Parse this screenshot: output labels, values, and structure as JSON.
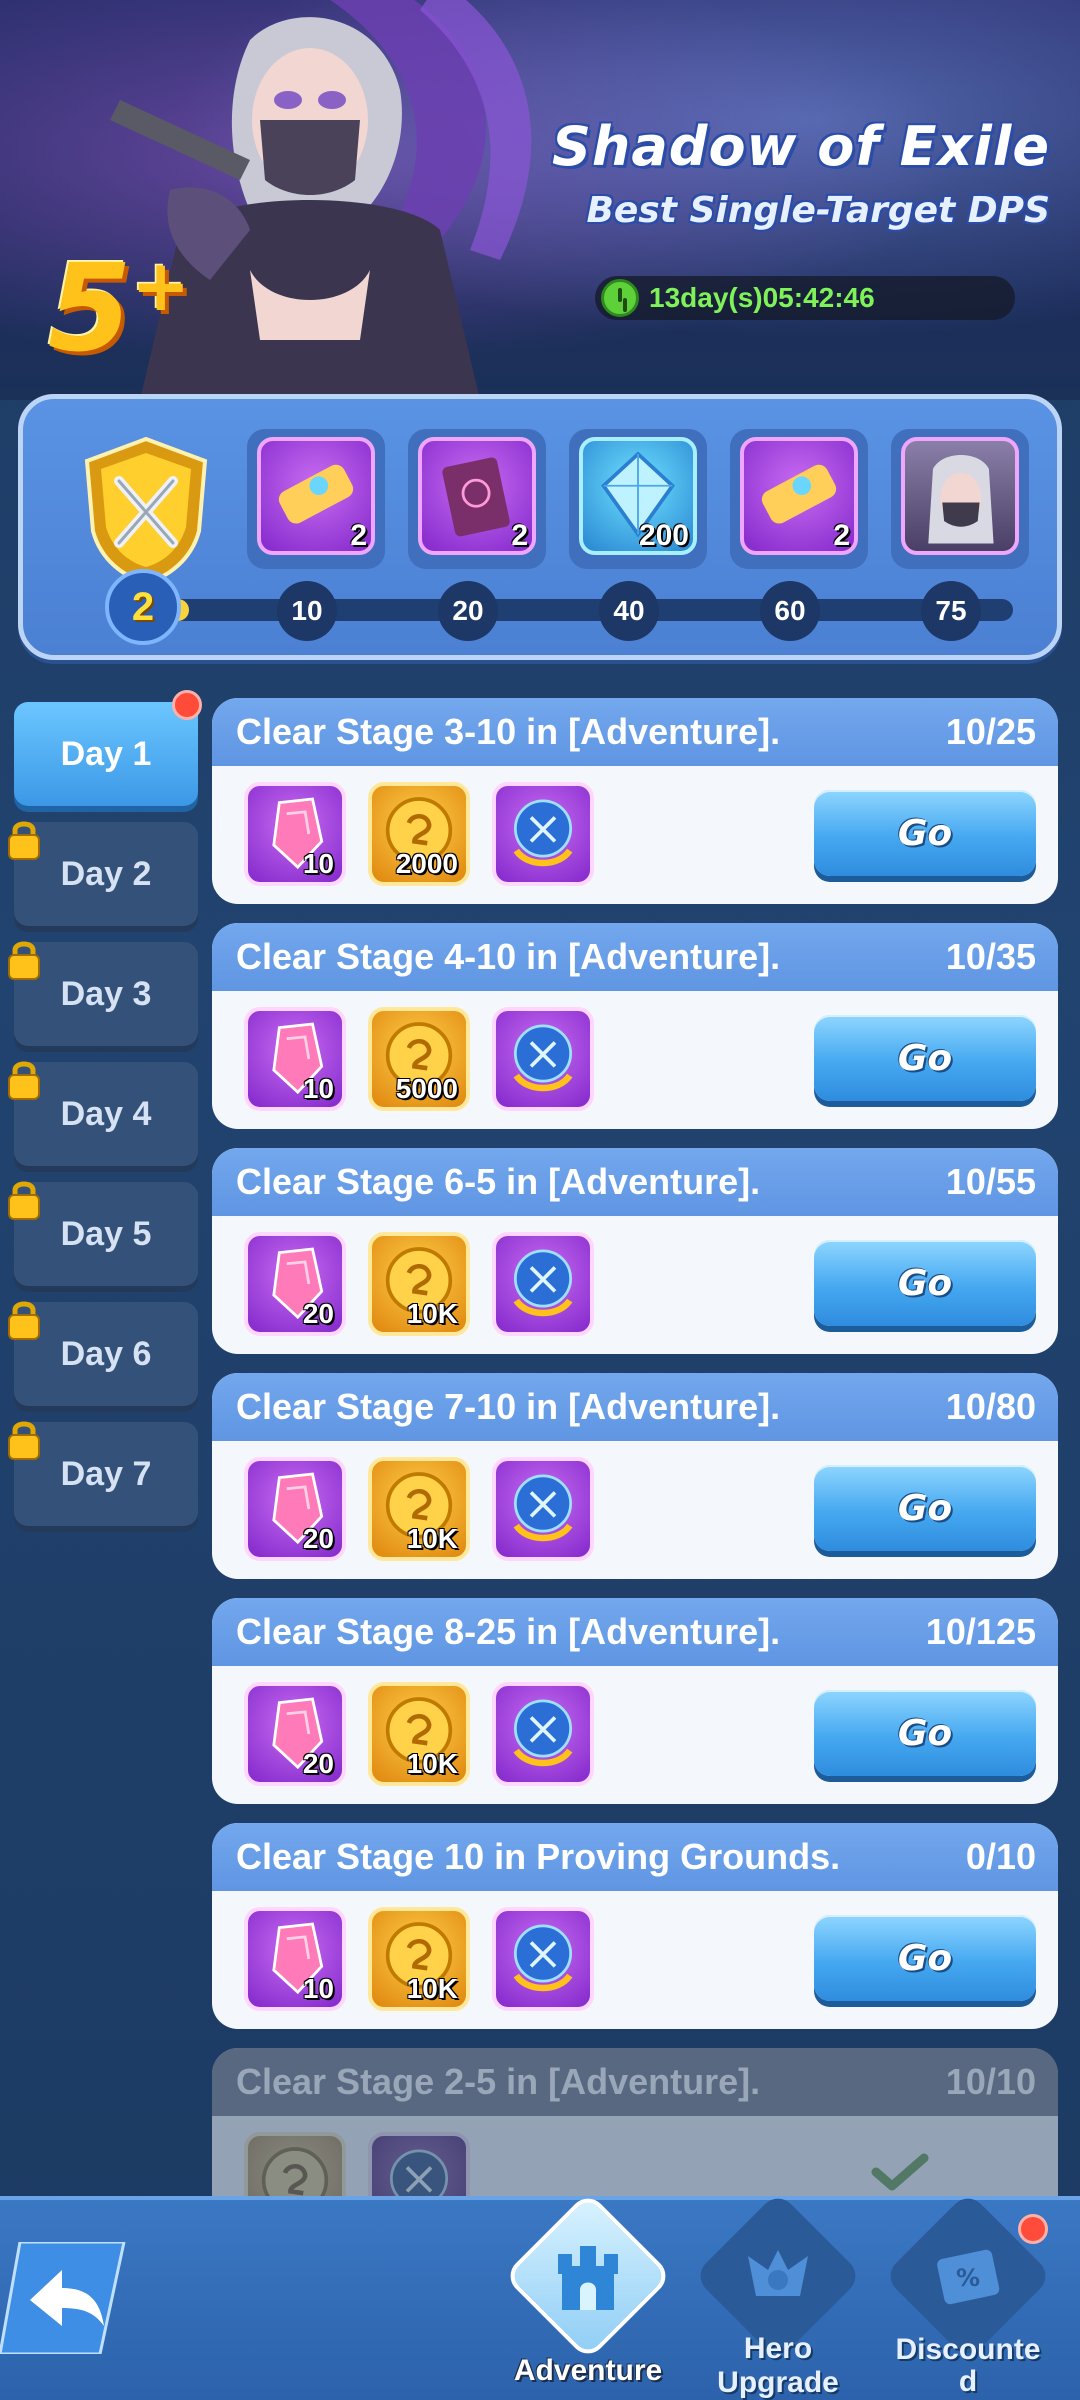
{
  "banner": {
    "title": "Shadow of Exile",
    "subtitle": "Best Single-Target DPS",
    "star_badge": "5",
    "star_badge_suffix": "+",
    "timer": "13day(s)05:42:46",
    "timer_icon": "clock-icon"
  },
  "progress": {
    "current_points": "2",
    "progress_fraction": 0.03,
    "rewards": [
      {
        "icon": "scroll-icon",
        "qty": "2"
      },
      {
        "icon": "summon-paper-icon",
        "qty": "2"
      },
      {
        "icon": "diamond-icon",
        "qty": "200"
      },
      {
        "icon": "scroll-icon",
        "qty": "2"
      },
      {
        "icon": "hero-portrait-icon",
        "qty": ""
      }
    ],
    "milestones": [
      "10",
      "20",
      "40",
      "60",
      "75"
    ]
  },
  "days": [
    {
      "label": "Day 1",
      "active": true,
      "locked": false,
      "has_notice": true
    },
    {
      "label": "Day 2",
      "active": false,
      "locked": true
    },
    {
      "label": "Day 3",
      "active": false,
      "locked": true
    },
    {
      "label": "Day 4",
      "active": false,
      "locked": true
    },
    {
      "label": "Day 5",
      "active": false,
      "locked": true
    },
    {
      "label": "Day 6",
      "active": false,
      "locked": true
    },
    {
      "label": "Day 7",
      "active": false,
      "locked": true
    }
  ],
  "tasks": [
    {
      "title": "Clear Stage 3-10 in [Adventure].",
      "progress": "10/25",
      "rewards": [
        "10",
        "2000",
        ""
      ],
      "button": "Go"
    },
    {
      "title": "Clear Stage 4-10 in [Adventure].",
      "progress": "10/35",
      "rewards": [
        "10",
        "5000",
        ""
      ],
      "button": "Go"
    },
    {
      "title": "Clear Stage 6-5 in [Adventure].",
      "progress": "10/55",
      "rewards": [
        "20",
        "10K",
        ""
      ],
      "button": "Go"
    },
    {
      "title": "Clear Stage 7-10 in [Adventure].",
      "progress": "10/80",
      "rewards": [
        "20",
        "10K",
        ""
      ],
      "button": "Go"
    },
    {
      "title": "Clear Stage 8-25 in [Adventure].",
      "progress": "10/125",
      "rewards": [
        "20",
        "10K",
        ""
      ],
      "button": "Go"
    },
    {
      "title": "Clear Stage 10 in Proving Grounds.",
      "progress": "0/10",
      "rewards": [
        "10",
        "10K",
        ""
      ],
      "button": "Go"
    },
    {
      "title": "Clear Stage 2-5 in [Adventure].",
      "progress": "10/10",
      "rewards": [],
      "button": ""
    }
  ],
  "nav": {
    "back_icon": "back-arrow-icon",
    "items": [
      {
        "label": "Adventure",
        "icon": "castle-icon",
        "active": true
      },
      {
        "label": "Hero\nUpgrade",
        "label_line1": "Hero",
        "label_line2": "Upgrade",
        "icon": "hero-upgrade-icon",
        "active": false
      },
      {
        "label_line1": "Discounte",
        "label_line2": "d",
        "icon": "discount-ticket-icon",
        "active": false,
        "has_notice": true
      }
    ]
  },
  "colors": {
    "accent_blue": "#5f95e2",
    "go_button": "#45a8f0",
    "gold": "#ffc21a",
    "timer_green": "#7ff25a",
    "notice_red": "#ff4b3a"
  }
}
